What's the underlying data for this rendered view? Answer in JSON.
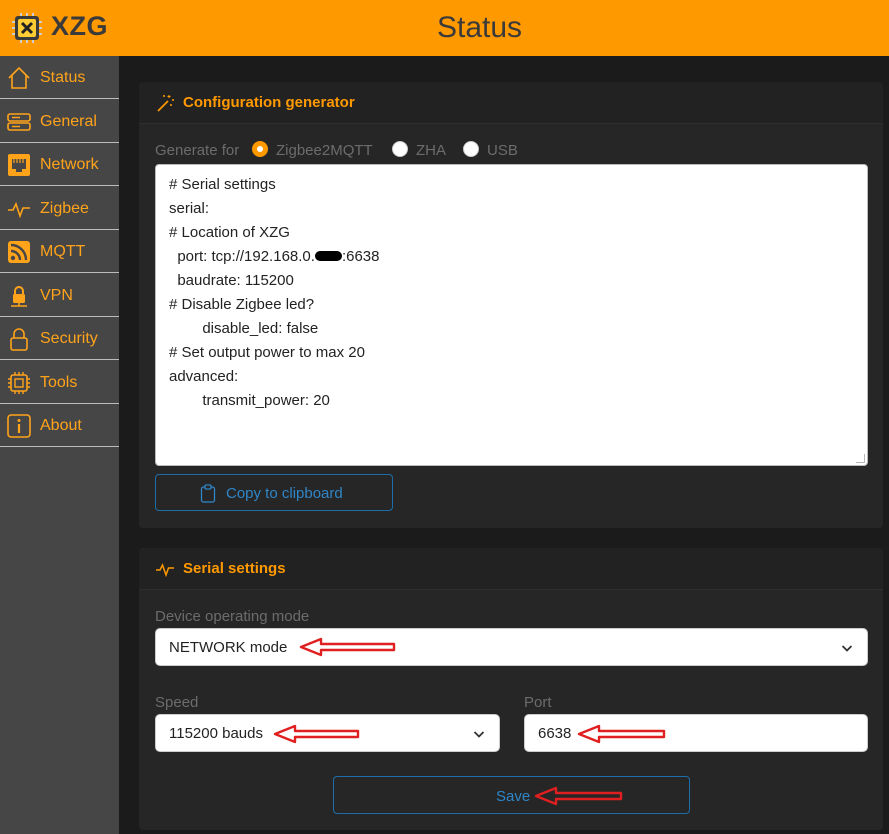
{
  "header": {
    "brand": "XZG",
    "page_title": "Status"
  },
  "sidebar": {
    "items": [
      {
        "label": "Status",
        "icon": "home-icon"
      },
      {
        "label": "General",
        "icon": "server-icon"
      },
      {
        "label": "Network",
        "icon": "ethernet-icon"
      },
      {
        "label": "Zigbee",
        "icon": "activity-icon"
      },
      {
        "label": "MQTT",
        "icon": "rss-icon"
      },
      {
        "label": "VPN",
        "icon": "vpn-lock-icon"
      },
      {
        "label": "Security",
        "icon": "lock-icon"
      },
      {
        "label": "Tools",
        "icon": "chip-icon"
      },
      {
        "label": "About",
        "icon": "info-icon"
      }
    ]
  },
  "config_generator": {
    "title": "Configuration generator",
    "generate_for_label": "Generate for",
    "options": [
      "Zigbee2MQTT",
      "ZHA",
      "USB"
    ],
    "selected": "Zigbee2MQTT",
    "code_lines": {
      "l1": "# Serial settings",
      "l2": "serial:",
      "l3": "# Location of XZG",
      "l4a": "  port: tcp://192.168.0.",
      "l4b": ":6638",
      "l5": "  baudrate: 115200",
      "l6": "# Disable Zigbee led?",
      "l7": "        disable_led: false",
      "l8": "# Set output power to max 20",
      "l9": "advanced:",
      "l10": "        transmit_power: 20"
    },
    "copy_label": "Copy to clipboard"
  },
  "serial_settings": {
    "title": "Serial settings",
    "mode_label": "Device operating mode",
    "mode_value": "NETWORK mode",
    "speed_label": "Speed",
    "speed_value": "115200 bauds",
    "port_label": "Port",
    "port_value": "6638",
    "save_label": "Save"
  },
  "colors": {
    "accent": "#ff9900",
    "sidebar_bg": "#464646",
    "link_blue": "#2f86c8",
    "annotation_red": "#e02020"
  }
}
